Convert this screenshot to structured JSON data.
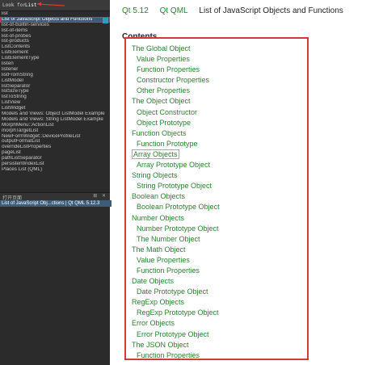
{
  "search": {
    "label": "Look for:",
    "value": "List"
  },
  "index_items": [
    "list",
    "List of JavaScript Objects and Functions",
    "list-of-builtin-services",
    "list-of-items",
    "list-of-probes",
    "list-products",
    "ListContents",
    "ListElement",
    "ListElementType",
    "listen",
    "listener",
    "listFromString",
    "ListModel",
    "listSeparator",
    "listSizeType",
    "listToString",
    "ListView",
    "ListWidget",
    "Models and Views: Object ListModel Example",
    "Models and Views: String ListModel Example",
    "MorphMenu::ActionList",
    "morphTargetList",
    "NewFormWidget::DeviceProfileList",
    "outputFormatList",
    "overrideListProperties",
    "pageList",
    "pathListSeparator",
    "persistentIndexList",
    "Places List (QML)"
  ],
  "selected_index": 1,
  "open_pages": {
    "title": "打开页面",
    "icons": "⊞ ✕",
    "current": "List of JavaScript Obj...ctions | Qt QML 5.12.3"
  },
  "breadcrumbs": [
    "Qt 5.12",
    "Qt QML",
    "List of JavaScript Objects and Functions"
  ],
  "contents_title": "Contents",
  "toc": [
    {
      "text": "The Global Object",
      "sub": false
    },
    {
      "text": "Value Properties",
      "sub": true
    },
    {
      "text": "Function Properties",
      "sub": true
    },
    {
      "text": "Constructor Properties",
      "sub": true
    },
    {
      "text": "Other Properties",
      "sub": true
    },
    {
      "text": "The Object Object",
      "sub": false
    },
    {
      "text": "Object Constructor",
      "sub": true
    },
    {
      "text": "Object Prototype",
      "sub": true
    },
    {
      "text": "Function Objects",
      "sub": false
    },
    {
      "text": "Function Prototype",
      "sub": true
    },
    {
      "text": "Array Objects",
      "sub": false,
      "boxed": true
    },
    {
      "text": "Array Prototype Object",
      "sub": true
    },
    {
      "text": "String Objects",
      "sub": false
    },
    {
      "text": "String Prototype Object",
      "sub": true
    },
    {
      "text": "Boolean Objects",
      "sub": false
    },
    {
      "text": "Boolean Prototype Object",
      "sub": true
    },
    {
      "text": "Number Objects",
      "sub": false
    },
    {
      "text": "Number Prototype Object",
      "sub": true
    },
    {
      "text": "The Number Object",
      "sub": true
    },
    {
      "text": "The Math Object",
      "sub": false
    },
    {
      "text": "Value Properties",
      "sub": true
    },
    {
      "text": "Function Properties",
      "sub": true
    },
    {
      "text": "Date Objects",
      "sub": false
    },
    {
      "text": "Date Prototype Object",
      "sub": true
    },
    {
      "text": "RegExp Objects",
      "sub": false
    },
    {
      "text": "RegExp Prototype Object",
      "sub": true
    },
    {
      "text": "Error Objects",
      "sub": false
    },
    {
      "text": "Error Prototype Object",
      "sub": true
    },
    {
      "text": "The JSON Object",
      "sub": false
    },
    {
      "text": "Function Properties",
      "sub": true
    }
  ]
}
